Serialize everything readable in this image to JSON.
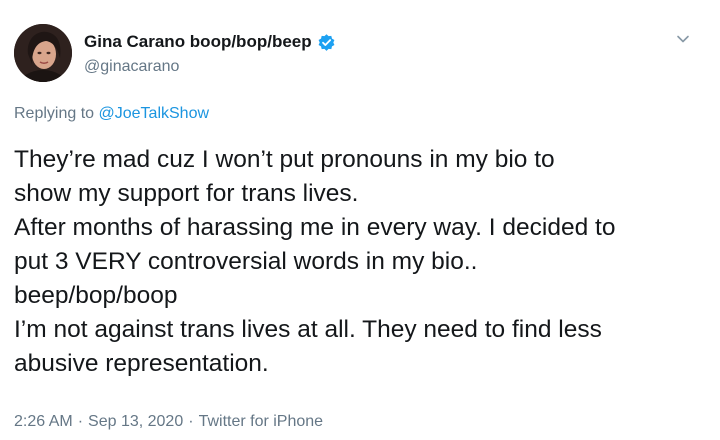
{
  "tweet": {
    "display_name": "Gina Carano boop/bop/beep",
    "handle": "@ginacarano",
    "verified": true,
    "reply_prefix": "Replying to",
    "reply_to": "@JoeTalkShow",
    "text_lines": [
      "They’re mad cuz I won’t put pronouns in my bio to",
      "show my support for trans lives.",
      "After months of harassing me in every way. I decided to",
      "put 3 VERY controversial words in my bio..",
      "beep/bop/boop",
      "I’m not against trans lives at all. They need to find less",
      "abusive representation."
    ],
    "time": "2:26 AM",
    "separator": "·",
    "date": "Sep 13, 2020",
    "source": "Twitter for iPhone"
  },
  "icons": {
    "verified": "verified-badge-icon",
    "menu": "chevron-down-icon"
  },
  "colors": {
    "link": "#1b95e0",
    "secondary_text": "#657786",
    "primary_text": "#14171a",
    "verified_badge": "#1da1f2"
  }
}
